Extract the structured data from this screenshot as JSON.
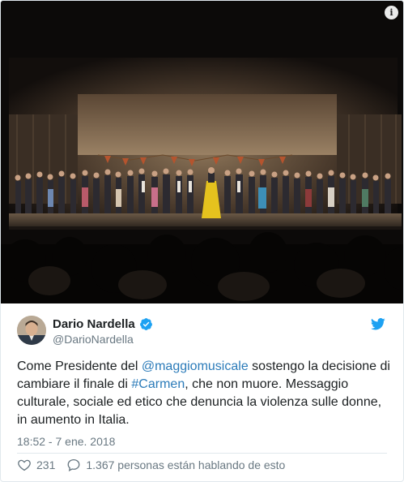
{
  "user": {
    "display_name": "Dario Nardella",
    "handle": "@DarioNardella"
  },
  "tweet": {
    "text_1": "Come Presidente del ",
    "mention": "@maggiomusicale",
    "text_2": " sostengo la decisione di cambiare il finale di ",
    "hashtag": "#Carmen",
    "text_3": ", che non muore. Messaggio culturale, sociale ed etico che denuncia la violenza sulle donne, in aumento in Italia.",
    "timestamp": "18:52 - 7 ene. 2018"
  },
  "actions": {
    "likes": "231",
    "conversation": "1.367 personas están hablando de esto"
  },
  "icons": {
    "info": "info-icon",
    "verified": "verified-badge-icon",
    "brand": "twitter-bird-icon",
    "like": "heart-icon",
    "reply": "speech-bubble-icon"
  },
  "colors": {
    "link": "#2b7bb9",
    "twitter_blue": "#1da1f2",
    "muted": "#697882",
    "text": "#1c2022"
  }
}
